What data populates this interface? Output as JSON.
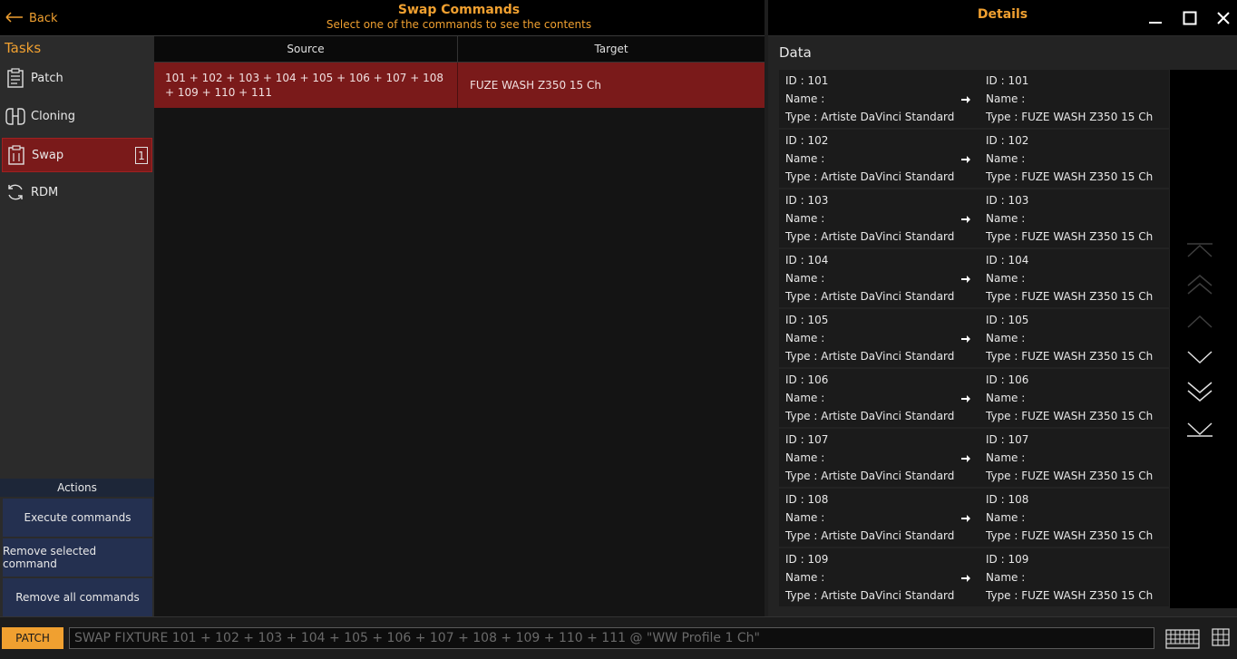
{
  "header": {
    "back_label": "Back",
    "title": "Swap Commands",
    "subtitle": "Select one of the commands to see the contents"
  },
  "sidebar": {
    "title": "Tasks",
    "items": [
      {
        "label": "Patch",
        "icon": "clipboard-icon"
      },
      {
        "label": "Cloning",
        "icon": "cloning-icon"
      },
      {
        "label": "Swap",
        "icon": "swap-icon",
        "count": "1",
        "selected": true
      },
      {
        "label": "RDM",
        "icon": "refresh-icon"
      }
    ]
  },
  "actions": {
    "title": "Actions",
    "execute_label": "Execute commands",
    "remove_selected_label": "Remove selected command",
    "remove_all_label": "Remove all commands"
  },
  "table": {
    "columns": [
      "Source",
      "Target"
    ],
    "rows": [
      {
        "source": "101 + 102 + 103 + 104 + 105 + 106 + 107 + 108 + 109 + 110 + 111",
        "target": "FUZE WASH Z350 15 Ch"
      }
    ]
  },
  "details": {
    "title": "Details",
    "data_title": "Data",
    "items": [
      {
        "src_id": "ID : 101",
        "src_name": "Name :",
        "src_type": "Type : Artiste DaVinci Standard",
        "dst_id": "ID : 101",
        "dst_name": "Name :",
        "dst_type": "Type : FUZE WASH Z350 15 Ch"
      },
      {
        "src_id": "ID : 102",
        "src_name": "Name :",
        "src_type": "Type : Artiste DaVinci Standard",
        "dst_id": "ID : 102",
        "dst_name": "Name :",
        "dst_type": "Type : FUZE WASH Z350 15 Ch"
      },
      {
        "src_id": "ID : 103",
        "src_name": "Name :",
        "src_type": "Type : Artiste DaVinci Standard",
        "dst_id": "ID : 103",
        "dst_name": "Name :",
        "dst_type": "Type : FUZE WASH Z350 15 Ch"
      },
      {
        "src_id": "ID : 104",
        "src_name": "Name :",
        "src_type": "Type : Artiste DaVinci Standard",
        "dst_id": "ID : 104",
        "dst_name": "Name :",
        "dst_type": "Type : FUZE WASH Z350 15 Ch"
      },
      {
        "src_id": "ID : 105",
        "src_name": "Name :",
        "src_type": "Type : Artiste DaVinci Standard",
        "dst_id": "ID : 105",
        "dst_name": "Name :",
        "dst_type": "Type : FUZE WASH Z350 15 Ch"
      },
      {
        "src_id": "ID : 106",
        "src_name": "Name :",
        "src_type": "Type : Artiste DaVinci Standard",
        "dst_id": "ID : 106",
        "dst_name": "Name :",
        "dst_type": "Type : FUZE WASH Z350 15 Ch"
      },
      {
        "src_id": "ID : 107",
        "src_name": "Name :",
        "src_type": "Type : Artiste DaVinci Standard",
        "dst_id": "ID : 107",
        "dst_name": "Name :",
        "dst_type": "Type : FUZE WASH Z350 15 Ch"
      },
      {
        "src_id": "ID : 108",
        "src_name": "Name :",
        "src_type": "Type : Artiste DaVinci Standard",
        "dst_id": "ID : 108",
        "dst_name": "Name :",
        "dst_type": "Type : FUZE WASH Z350 15 Ch"
      },
      {
        "src_id": "ID : 109",
        "src_name": "Name :",
        "src_type": "Type : Artiste DaVinci Standard",
        "dst_id": "ID : 109",
        "dst_name": "Name :",
        "dst_type": "Type : FUZE WASH Z350 15 Ch"
      }
    ]
  },
  "command_bar": {
    "patch_label": "PATCH",
    "command_text": "SWAP FIXTURE 101 + 102 + 103 + 104 + 105 + 106 + 107 + 108 + 109 + 110 + 111 @ \"WW Profile 1 Ch\""
  },
  "colors": {
    "accent": "#f0a030",
    "selected_row": "#7a1a1a",
    "action_button": "#243050"
  }
}
